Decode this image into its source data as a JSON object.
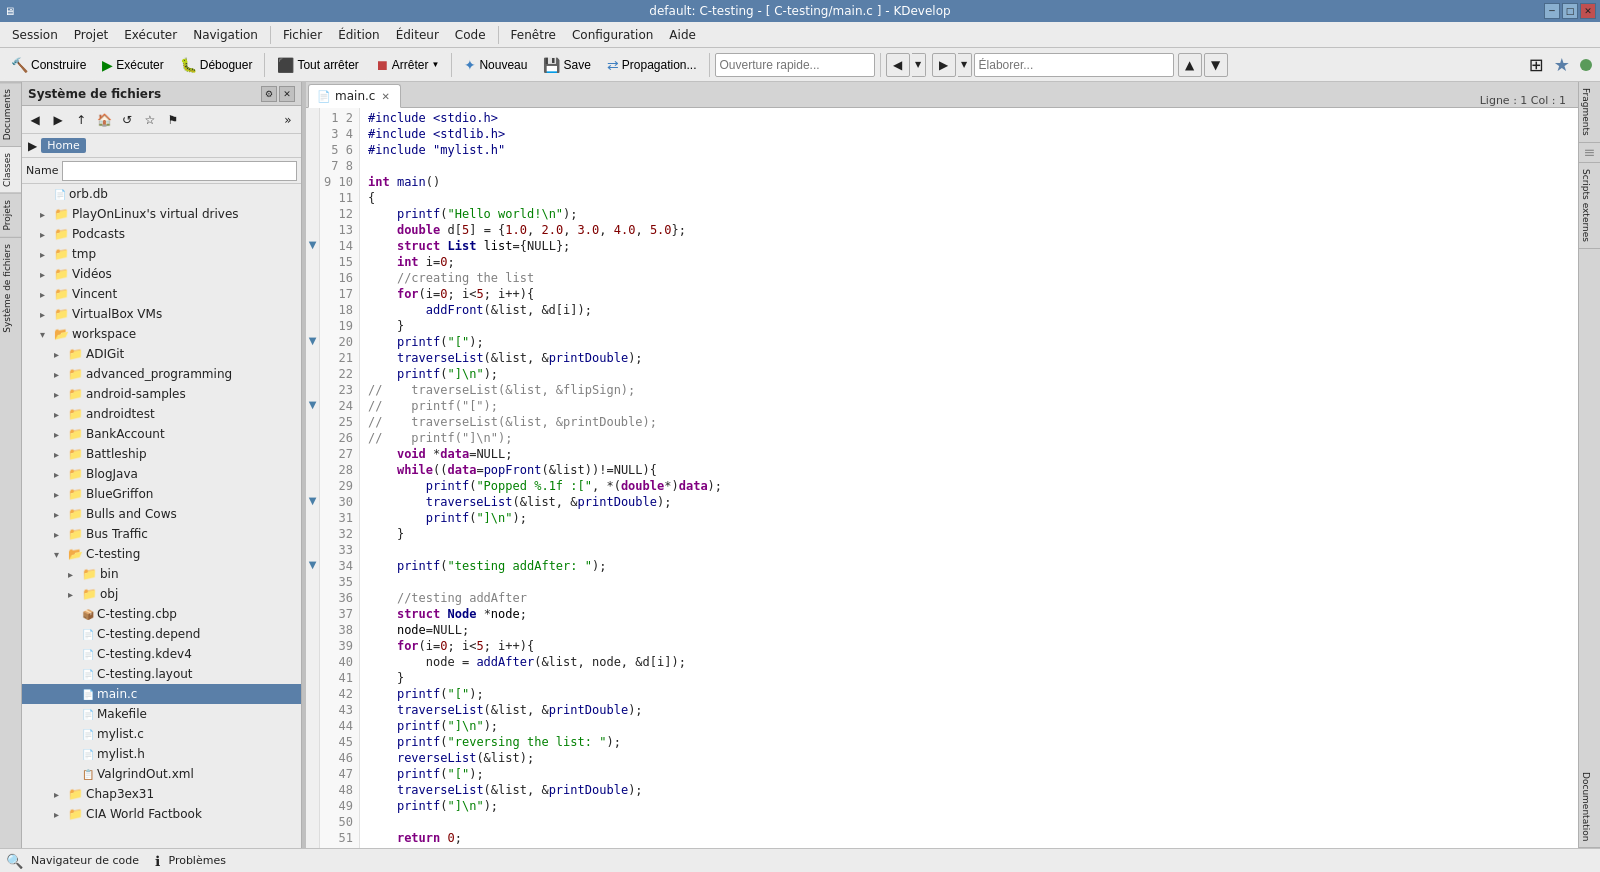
{
  "titlebar": {
    "title": "default:  C-testing - [ C-testing/main.c ] - KDevelop",
    "icon": "K"
  },
  "menubar": {
    "items": [
      "Session",
      "Projet",
      "Exécuter",
      "Navigation",
      "Fichier",
      "Édition",
      "Éditeur",
      "Code",
      "Fenêtre",
      "Configuration",
      "Aide"
    ]
  },
  "toolbar": {
    "build_label": "Construire",
    "run_label": "Exécuter",
    "debug_label": "Déboguer",
    "stop_all_label": "Tout arrêter",
    "stop_label": "Arrêter",
    "new_label": "Nouveau",
    "save_label": "Save",
    "propagate_label": "Propagation...",
    "quick_open_placeholder": "Ouverture rapide...",
    "elaborate_placeholder": "Élaborer..."
  },
  "file_panel": {
    "title": "Système de fichiers",
    "breadcrumb": "Home",
    "name_label": "Name",
    "tree": [
      {
        "label": "orb.db",
        "type": "file",
        "indent": 1,
        "icon": "db"
      },
      {
        "label": "PlayOnLinux's virtual drives",
        "type": "folder",
        "indent": 1,
        "collapsed": true
      },
      {
        "label": "Podcasts",
        "type": "folder",
        "indent": 1,
        "collapsed": true
      },
      {
        "label": "tmp",
        "type": "folder",
        "indent": 1,
        "collapsed": true
      },
      {
        "label": "Vidéos",
        "type": "folder",
        "indent": 1,
        "collapsed": true
      },
      {
        "label": "Vincent",
        "type": "folder",
        "indent": 1,
        "collapsed": true
      },
      {
        "label": "VirtualBox VMs",
        "type": "folder",
        "indent": 1,
        "collapsed": true
      },
      {
        "label": "workspace",
        "type": "folder",
        "indent": 1,
        "expanded": true
      },
      {
        "label": "ADIGit",
        "type": "folder",
        "indent": 2,
        "collapsed": true
      },
      {
        "label": "advanced_programming",
        "type": "folder",
        "indent": 2,
        "collapsed": true
      },
      {
        "label": "android-samples",
        "type": "folder",
        "indent": 2,
        "collapsed": true
      },
      {
        "label": "androidtest",
        "type": "folder",
        "indent": 2,
        "collapsed": true
      },
      {
        "label": "BankAccount",
        "type": "folder",
        "indent": 2,
        "collapsed": true
      },
      {
        "label": "Battleship",
        "type": "folder",
        "indent": 2,
        "collapsed": true
      },
      {
        "label": "BlogJava",
        "type": "folder",
        "indent": 2,
        "collapsed": true
      },
      {
        "label": "BlueGriffon",
        "type": "folder",
        "indent": 2,
        "collapsed": true
      },
      {
        "label": "Bulls and Cows",
        "type": "folder",
        "indent": 2,
        "collapsed": true
      },
      {
        "label": "Bus Traffic",
        "type": "folder",
        "indent": 2,
        "collapsed": true
      },
      {
        "label": "C-testing",
        "type": "folder",
        "indent": 2,
        "expanded": true
      },
      {
        "label": "bin",
        "type": "folder",
        "indent": 3,
        "collapsed": true
      },
      {
        "label": "obj",
        "type": "folder",
        "indent": 3,
        "collapsed": true
      },
      {
        "label": "C-testing.cbp",
        "type": "file-proj",
        "indent": 3
      },
      {
        "label": "C-testing.depend",
        "type": "file-plain",
        "indent": 3
      },
      {
        "label": "C-testing.kdev4",
        "type": "file-plain",
        "indent": 3
      },
      {
        "label": "C-testing.layout",
        "type": "file-plain",
        "indent": 3
      },
      {
        "label": "main.c",
        "type": "file-c",
        "indent": 3,
        "selected": true
      },
      {
        "label": "Makefile",
        "type": "file-plain",
        "indent": 3
      },
      {
        "label": "mylist.c",
        "type": "file-c",
        "indent": 3
      },
      {
        "label": "mylist.h",
        "type": "file-h",
        "indent": 3
      },
      {
        "label": "ValgrindOut.xml",
        "type": "file-xml",
        "indent": 3
      },
      {
        "label": "Chap3ex31",
        "type": "folder",
        "indent": 2,
        "collapsed": true
      },
      {
        "label": "CIA World Factbook",
        "type": "folder",
        "indent": 2,
        "collapsed": true
      }
    ]
  },
  "editor": {
    "tab_label": "main.c",
    "status_line": "Ligne : 1 Col : 1"
  },
  "right_sidebar": {
    "tabs": [
      "Fragments",
      "Scripts externes",
      "Documentation"
    ]
  },
  "statusbar": {
    "nav_label": "Navigateur de code",
    "problems_label": "Problèmes"
  }
}
